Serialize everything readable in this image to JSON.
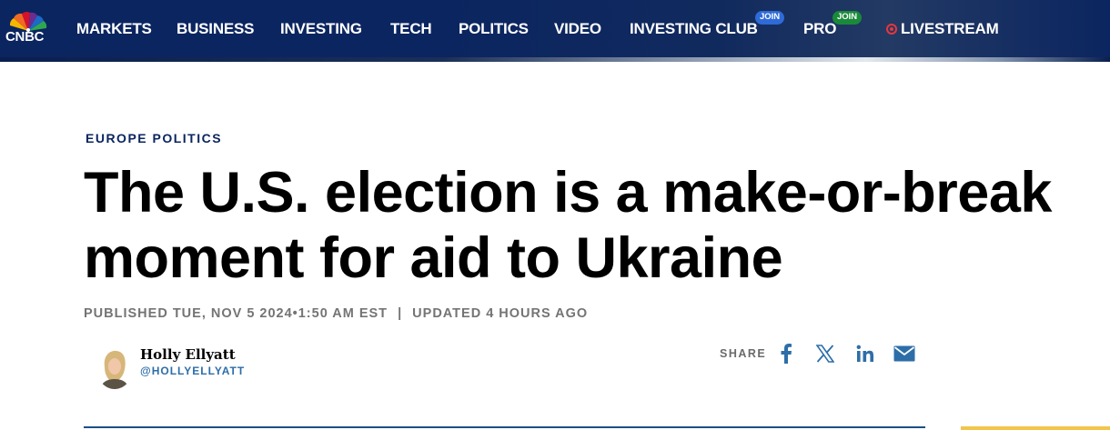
{
  "header": {
    "logo_text": "CNBC",
    "nav": [
      {
        "label": "MARKETS"
      },
      {
        "label": "BUSINESS"
      },
      {
        "label": "INVESTING"
      },
      {
        "label": "TECH"
      },
      {
        "label": "POLITICS"
      },
      {
        "label": "VIDEO"
      },
      {
        "label": "INVESTING CLUB",
        "badge": "JOIN"
      },
      {
        "label": "PRO",
        "badge": "JOIN"
      },
      {
        "label": "LIVESTREAM"
      }
    ]
  },
  "article": {
    "section": "EUROPE POLITICS",
    "headline": "The U.S. election is a make-or-break moment for aid to Ukraine",
    "published": "PUBLISHED TUE, NOV 5 2024•1:50 AM EST",
    "separator": "|",
    "updated": "UPDATED 4 HOURS AGO",
    "author": {
      "name": "Holly Ellyatt",
      "handle": "@HOLLYELLYATT"
    },
    "share": {
      "label": "SHARE",
      "icons": [
        "facebook-icon",
        "x-icon",
        "linkedin-icon",
        "email-icon"
      ]
    }
  },
  "colors": {
    "nav_bg": "#0b2560",
    "accent_blue": "#2d6ea8",
    "section": "#0b2560",
    "live_red": "#e8363c",
    "join_blue": "#2f6bd8",
    "join_green": "#1a8a3a",
    "footer_yellow": "#f1c64a"
  }
}
